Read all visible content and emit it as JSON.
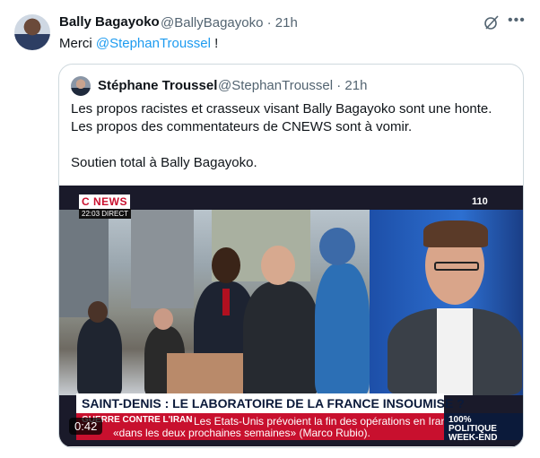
{
  "tweet": {
    "author_name": "Bally Bagayoko",
    "author_handle_meta": "@BallyBagayoko · 21h",
    "text_prefix": "Merci ",
    "mention": "@StephanTroussel",
    "text_suffix": " !",
    "more_icon": "more-icon",
    "grok_icon": "grok-icon"
  },
  "quote": {
    "author_name": "Stéphane Troussel",
    "author_handle_meta": "@StephanTroussel · 21h",
    "text": "Les propos racistes et crasseux visant Bally Bagayoko sont une honte.\nLes propos des commentateurs de CNEWS sont à vomir.\n\nSoutien total à Bally Bagayoko.",
    "video": {
      "channel_logo": "C NEWS",
      "time_badge": "22:03 DIRECT",
      "channel_number": "110",
      "headline": "SAINT-DENIS : LE LABORATOIRE DE LA FRANCE INSOUMISE ?",
      "ticker_label": "GUERRE CONTRE L'IRAN",
      "ticker_line1": "Les Etats-Unis prévoient la fin des opérations en Iran",
      "ticker_line2": "«dans les deux prochaines semaines» (Marco Rubio).",
      "program_line1": "100%",
      "program_line2": "POLITIQUE",
      "program_line3": "WEEK-END",
      "duration": "0:42"
    }
  }
}
